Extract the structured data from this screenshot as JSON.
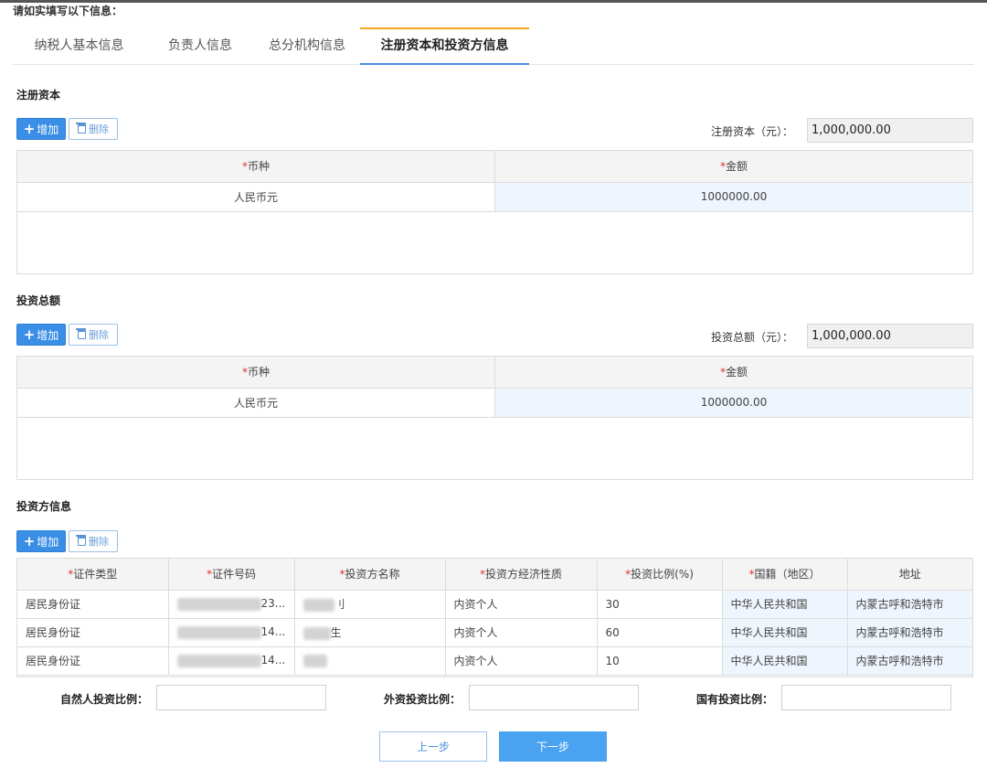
{
  "notice": "请如实填写以下信息：",
  "tabs": [
    {
      "label": "纳税人基本信息"
    },
    {
      "label": "负责人信息"
    },
    {
      "label": "总分机构信息"
    },
    {
      "label": "注册资本和投资方信息"
    }
  ],
  "registered_capital": {
    "title": "注册资本",
    "add_label": "增加",
    "delete_label": "删除",
    "total_label": "注册资本（元）：",
    "total_value": "1,000,000.00",
    "columns": [
      "币种",
      "金额"
    ],
    "rows": [
      {
        "currency": "人民币元",
        "amount": "1000000.00"
      }
    ]
  },
  "investment_total": {
    "title": "投资总额",
    "add_label": "增加",
    "delete_label": "删除",
    "total_label": "投资总额（元）：",
    "total_value": "1,000,000.00",
    "columns": [
      "币种",
      "金额"
    ],
    "rows": [
      {
        "currency": "人民币元",
        "amount": "1000000.00"
      }
    ]
  },
  "investors": {
    "title": "投资方信息",
    "add_label": "增加",
    "delete_label": "删除",
    "columns": [
      "证件类型",
      "证件号码",
      "投资方名称",
      "投资方经济性质",
      "投资比例(%)",
      "国籍（地区）",
      "地址"
    ],
    "rows": [
      {
        "id_type": "居民身份证",
        "id_suffix": "23...",
        "name_suffix": "刂",
        "nature": "内资个人",
        "ratio": "30",
        "nationality": "中华人民共和国",
        "address": "内蒙古呼和浩特市"
      },
      {
        "id_type": "居民身份证",
        "id_suffix": "14...",
        "name_suffix": "生",
        "nature": "内资个人",
        "ratio": "60",
        "nationality": "中华人民共和国",
        "address": "内蒙古呼和浩特市"
      },
      {
        "id_type": "居民身份证",
        "id_suffix": "14...",
        "name_suffix": "",
        "nature": "内资个人",
        "ratio": "10",
        "nationality": "中华人民共和国",
        "address": "内蒙古呼和浩特市"
      }
    ]
  },
  "ratios": {
    "natural": "自然人投资比例：",
    "foreign": "外资投资比例：",
    "state": "国有投资比例："
  },
  "nav": {
    "prev": "上一步",
    "next": "下一步"
  }
}
